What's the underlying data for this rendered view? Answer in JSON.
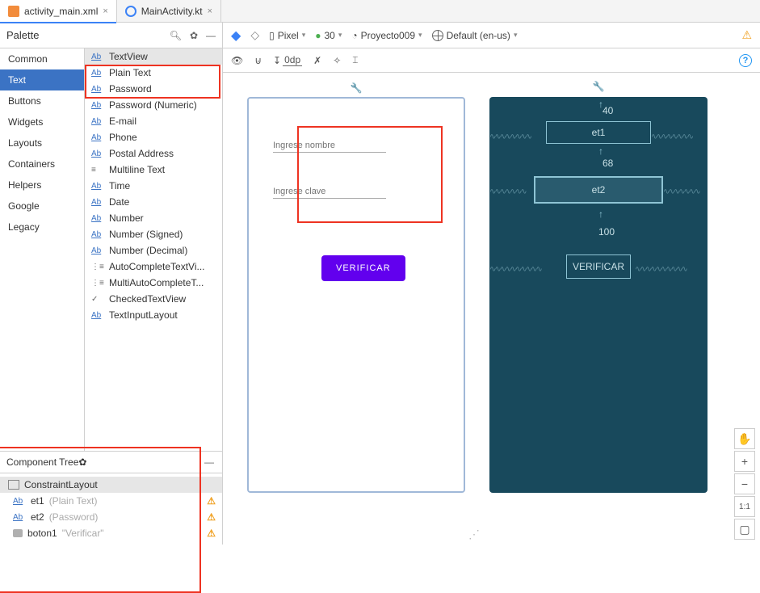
{
  "tabs": [
    {
      "label": "activity_main.xml",
      "active": true
    },
    {
      "label": "MainActivity.kt",
      "active": false
    }
  ],
  "palette": {
    "title": "Palette",
    "categories": [
      "Common",
      "Text",
      "Buttons",
      "Widgets",
      "Layouts",
      "Containers",
      "Helpers",
      "Google",
      "Legacy"
    ],
    "selected_category": "Text",
    "items": [
      "TextView",
      "Plain Text",
      "Password",
      "Password (Numeric)",
      "E-mail",
      "Phone",
      "Postal Address",
      "Multiline Text",
      "Time",
      "Date",
      "Number",
      "Number (Signed)",
      "Number (Decimal)",
      "AutoCompleteTextVi...",
      "MultiAutoCompleteT...",
      "CheckedTextView",
      "TextInputLayout"
    ]
  },
  "component_tree": {
    "title": "Component Tree",
    "root": "ConstraintLayout",
    "children": [
      {
        "id": "et1",
        "type": "(Plain Text)"
      },
      {
        "id": "et2",
        "type": "(Password)"
      },
      {
        "id": "boton1",
        "type": "\"Verificar\""
      }
    ]
  },
  "toolbar": {
    "device": "Pixel",
    "api": "30",
    "theme": "Proyecto009",
    "locale": "Default (en-us)",
    "odp": "0dp"
  },
  "design": {
    "input1_placeholder": "Ingrese nombre",
    "input2_placeholder": "Ingrese clave",
    "button_label": "VERIFICAR"
  },
  "blueprint": {
    "box1": "et1",
    "box2": "et2",
    "box3": "VERIFICAR",
    "spacing_top": "40",
    "spacing_mid": "68",
    "spacing_bot": "100"
  },
  "float_tools": {
    "ratio": "1:1"
  }
}
